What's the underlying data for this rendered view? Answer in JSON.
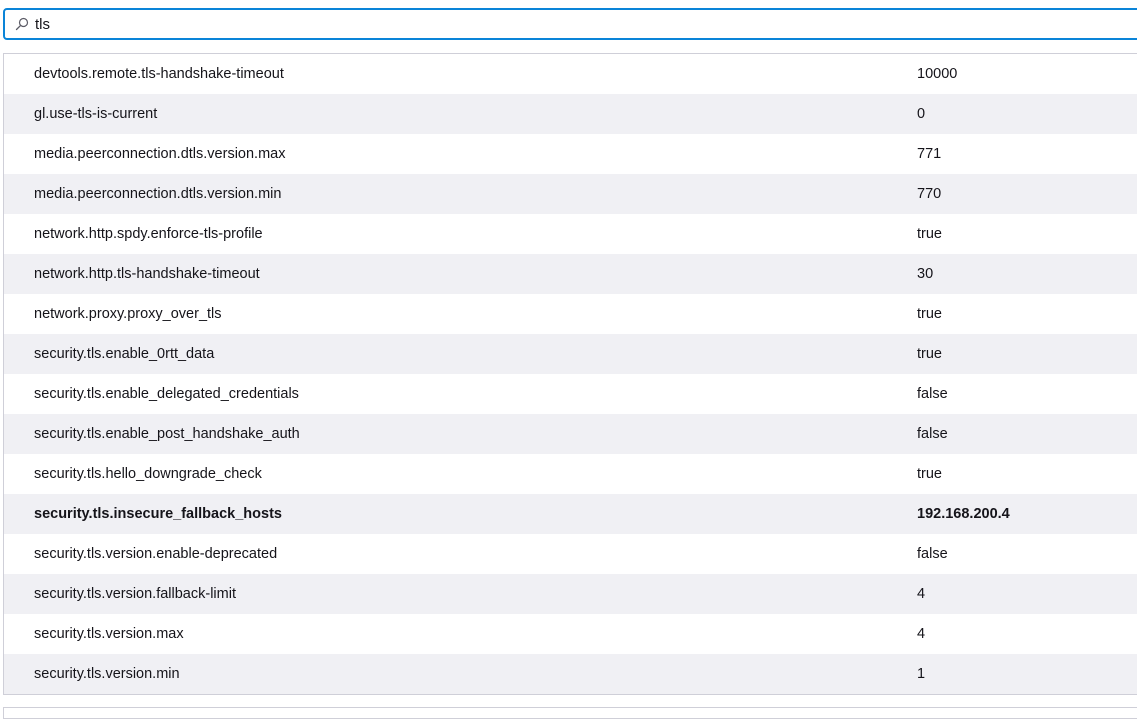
{
  "search": {
    "value": "tls",
    "icon": "search-icon"
  },
  "colors": {
    "focus_border": "#0a84d8",
    "alt_row": "#f0f0f4",
    "border": "#cfcfd8"
  },
  "prefs": [
    {
      "name": "devtools.remote.tls-handshake-timeout",
      "value": "10000",
      "modified": false
    },
    {
      "name": "gl.use-tls-is-current",
      "value": "0",
      "modified": false
    },
    {
      "name": "media.peerconnection.dtls.version.max",
      "value": "771",
      "modified": false
    },
    {
      "name": "media.peerconnection.dtls.version.min",
      "value": "770",
      "modified": false
    },
    {
      "name": "network.http.spdy.enforce-tls-profile",
      "value": "true",
      "modified": false
    },
    {
      "name": "network.http.tls-handshake-timeout",
      "value": "30",
      "modified": false
    },
    {
      "name": "network.proxy.proxy_over_tls",
      "value": "true",
      "modified": false
    },
    {
      "name": "security.tls.enable_0rtt_data",
      "value": "true",
      "modified": false
    },
    {
      "name": "security.tls.enable_delegated_credentials",
      "value": "false",
      "modified": false
    },
    {
      "name": "security.tls.enable_post_handshake_auth",
      "value": "false",
      "modified": false
    },
    {
      "name": "security.tls.hello_downgrade_check",
      "value": "true",
      "modified": false
    },
    {
      "name": "security.tls.insecure_fallback_hosts",
      "value": "192.168.200.4",
      "modified": true
    },
    {
      "name": "security.tls.version.enable-deprecated",
      "value": "false",
      "modified": false
    },
    {
      "name": "security.tls.version.fallback-limit",
      "value": "4",
      "modified": false
    },
    {
      "name": "security.tls.version.max",
      "value": "4",
      "modified": false
    },
    {
      "name": "security.tls.version.min",
      "value": "1",
      "modified": false
    }
  ]
}
